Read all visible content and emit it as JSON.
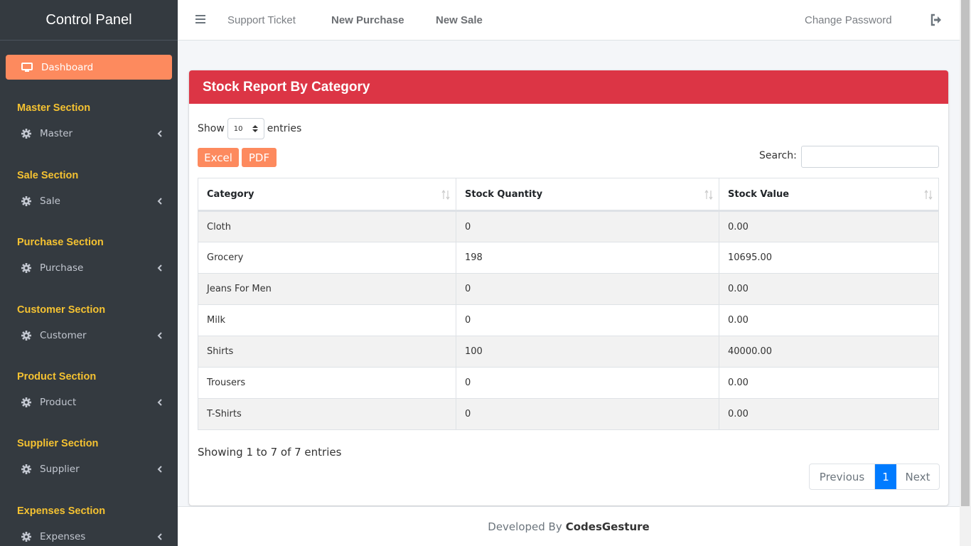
{
  "app": {
    "brand": "Control Panel",
    "dashboard_label": "Dashboard"
  },
  "sidebar": {
    "sections": [
      {
        "title": "Master Section",
        "item": "Master"
      },
      {
        "title": "Sale Section",
        "item": "Sale"
      },
      {
        "title": "Purchase Section",
        "item": "Purchase"
      },
      {
        "title": "Customer Section",
        "item": "Customer"
      },
      {
        "title": "Product Section",
        "item": "Product"
      },
      {
        "title": "Supplier Section",
        "item": "Supplier"
      },
      {
        "title": "Expenses Section",
        "item": "Expenses"
      }
    ]
  },
  "topnav": {
    "support": "Support Ticket",
    "new_purchase": "New Purchase",
    "new_sale": "New Sale",
    "change_password": "Change Password"
  },
  "card": {
    "title": "Stock Report By Category",
    "show_label": "Show",
    "entries_label": "entries",
    "page_size": "10",
    "excel_label": "Excel",
    "pdf_label": "PDF",
    "search_label": "Search:",
    "search_value": ""
  },
  "table": {
    "headers": [
      "Category",
      "Stock Quantity",
      "Stock Value"
    ],
    "rows": [
      [
        "Cloth",
        "0",
        "0.00"
      ],
      [
        "Grocery",
        "198",
        "10695.00"
      ],
      [
        "Jeans For Men",
        "0",
        "0.00"
      ],
      [
        "Milk",
        "0",
        "0.00"
      ],
      [
        "Shirts",
        "100",
        "40000.00"
      ],
      [
        "Trousers",
        "0",
        "0.00"
      ],
      [
        "T-Shirts",
        "0",
        "0.00"
      ]
    ]
  },
  "pagination": {
    "info": "Showing 1 to 7 of 7 entries",
    "previous": "Previous",
    "current": "1",
    "next": "Next"
  },
  "footer": {
    "prefix": "Developed By",
    "company": "CodesGesture"
  },
  "colors": {
    "sidebar": "#343a40",
    "accent": "#fd8a5e",
    "header_red": "#dc3545",
    "section_title": "#f5c231",
    "page_active": "#007bff"
  }
}
